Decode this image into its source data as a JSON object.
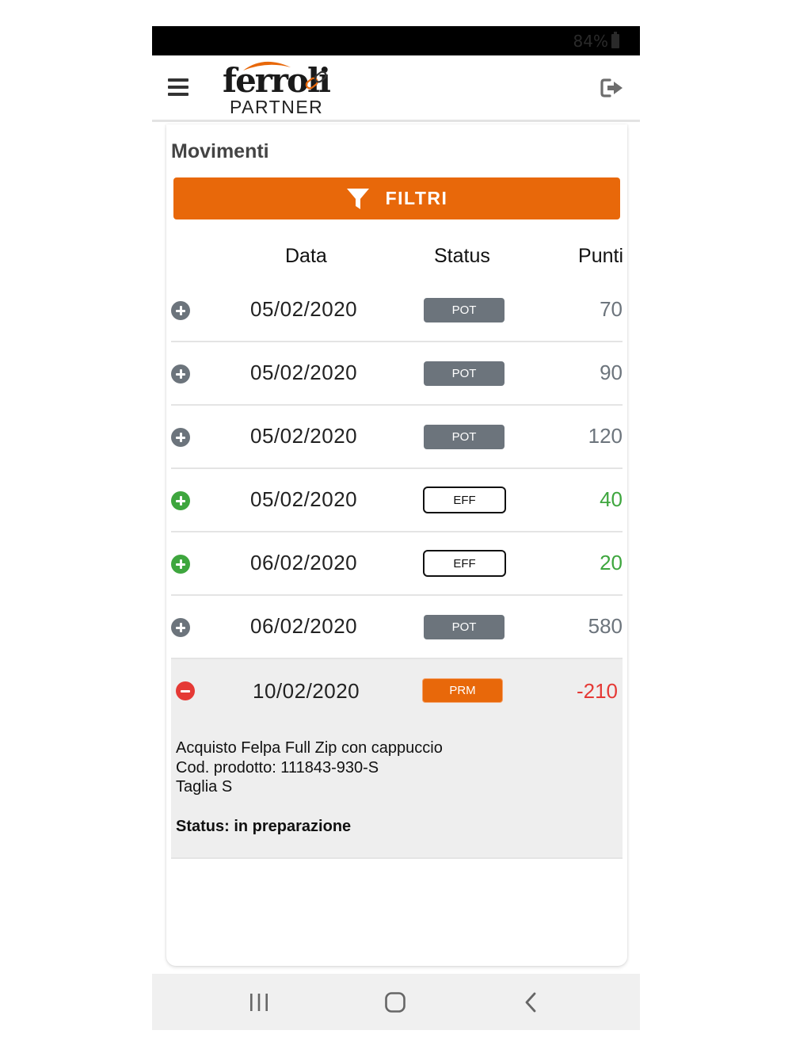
{
  "status_bar": {
    "battery": "84%"
  },
  "header": {
    "logo_word": "ferroli",
    "logo_sub": "PARTNER",
    "menu_icon": "hamburger-menu-icon",
    "logout_icon": "sign-out-icon"
  },
  "page": {
    "title": "Movimenti",
    "filter_label": "FILTRI",
    "filter_icon": "funnel-icon"
  },
  "table": {
    "headers": {
      "data": "Data",
      "status": "Status",
      "punti": "Punti"
    },
    "rows": [
      {
        "date": "05/02/2020",
        "status": "POT",
        "punti": "70"
      },
      {
        "date": "05/02/2020",
        "status": "POT",
        "punti": "90"
      },
      {
        "date": "05/02/2020",
        "status": "POT",
        "punti": "120"
      },
      {
        "date": "05/02/2020",
        "status": "EFF",
        "punti": "40"
      },
      {
        "date": "06/02/2020",
        "status": "EFF",
        "punti": "20"
      },
      {
        "date": "06/02/2020",
        "status": "POT",
        "punti": "580"
      },
      {
        "date": "10/02/2020",
        "status": "PRM",
        "punti": "-210",
        "details": {
          "line1": "Acquisto Felpa Full Zip con cappuccio",
          "line2": "Cod. prodotto: 111843-930-S",
          "line3": "Taglia S",
          "status_line": "Status: in preparazione"
        }
      }
    ]
  },
  "colors": {
    "accent": "#e8680a",
    "pot_badge": "#6c747c",
    "positive": "#3ea63e",
    "negative": "#e53935"
  },
  "nav": {
    "recents_icon": "recent-apps-icon",
    "home_icon": "home-icon",
    "back_icon": "back-icon"
  }
}
